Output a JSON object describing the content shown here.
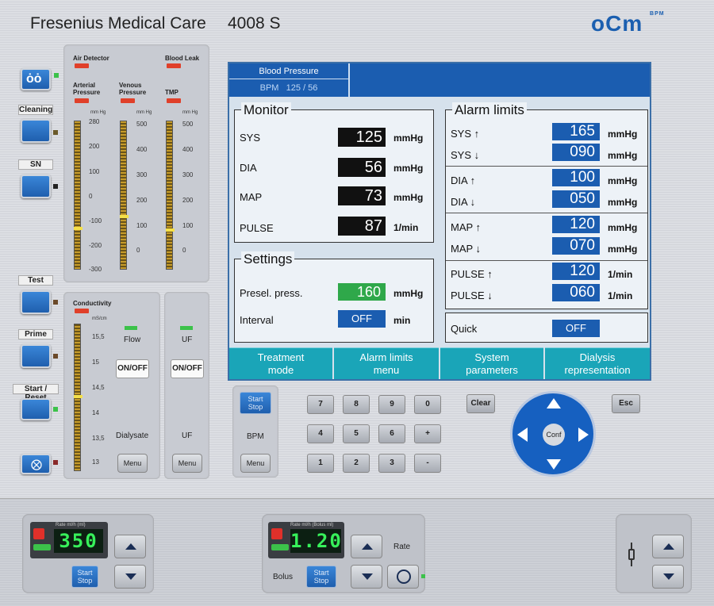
{
  "header": {
    "brand": "Fresenius Medical Care",
    "model": "4008 S",
    "logo": "oCm",
    "logo_small": "BPM"
  },
  "left_buttons": [
    {
      "label": "",
      "icon": "blood-pump-icon"
    },
    {
      "label": "Cleaning"
    },
    {
      "label": "SN"
    },
    {
      "label": "Test"
    },
    {
      "label": "Prime"
    },
    {
      "label": "Start / Reset"
    },
    {
      "label": "",
      "icon": "alarm-mute-icon"
    }
  ],
  "pressure_panel": {
    "air_detector": "Air Detector",
    "blood_leak": "Blood Leak",
    "arterial": "Arterial Pressure",
    "venous": "Venous Pressure",
    "tmp": "TMP",
    "unit": "mm Hg",
    "arterial_ticks": [
      "280",
      "200",
      "100",
      "0",
      "-100",
      "-200",
      "-300"
    ],
    "venous_ticks": [
      "500",
      "400",
      "300",
      "200",
      "100",
      "0"
    ],
    "tmp_ticks": [
      "500",
      "400",
      "300",
      "200",
      "100",
      "0"
    ]
  },
  "conductivity_panel": {
    "title": "Conductivity",
    "unit": "mS/cm",
    "ticks": [
      "15,5",
      "15",
      "14,5",
      "14",
      "13,5",
      "13"
    ],
    "flow_label": "Flow",
    "onoff": "ON/OFF",
    "dialysate_label": "Dialysate",
    "menu": "Menu"
  },
  "uf_panel": {
    "label_top": "UF",
    "onoff": "ON/OFF",
    "label_bottom": "UF",
    "menu": "Menu"
  },
  "screen": {
    "title": "Blood Pressure",
    "bpm": "BPM   125 / 56",
    "monitor": {
      "title": "Monitor",
      "rows": [
        {
          "label": "SYS",
          "value": "125",
          "unit": "mmHg"
        },
        {
          "label": "DIA",
          "value": "56",
          "unit": "mmHg"
        },
        {
          "label": "MAP",
          "value": "73",
          "unit": "mmHg"
        },
        {
          "label": "PULSE",
          "value": "87",
          "unit": "1/min"
        }
      ]
    },
    "settings": {
      "title": "Settings",
      "presel_label": "Presel. press.",
      "presel_value": "160",
      "presel_unit": "mmHg",
      "interval_label": "Interval",
      "interval_value": "OFF",
      "interval_unit": "min"
    },
    "alarm_limits": {
      "title": "Alarm limits",
      "rows": [
        {
          "label": "SYS ↑",
          "value": "165",
          "unit": "mmHg"
        },
        {
          "label": "SYS ↓",
          "value": "090",
          "unit": "mmHg"
        },
        {
          "label": "DIA ↑",
          "value": "100",
          "unit": "mmHg"
        },
        {
          "label": "DIA ↓",
          "value": "050",
          "unit": "mmHg"
        },
        {
          "label": "MAP ↑",
          "value": "120",
          "unit": "mmHg"
        },
        {
          "label": "MAP ↓",
          "value": "070",
          "unit": "mmHg"
        },
        {
          "label": "PULSE ↑",
          "value": "120",
          "unit": "1/min"
        },
        {
          "label": "PULSE ↓",
          "value": "060",
          "unit": "1/min"
        }
      ]
    },
    "quick": {
      "label": "Quick",
      "value": "OFF"
    },
    "menu": [
      {
        "line1": "Treatment",
        "line2": "mode"
      },
      {
        "line1": "Alarm limits",
        "line2": "menu"
      },
      {
        "line1": "System",
        "line2": "parameters"
      },
      {
        "line1": "Dialysis",
        "line2": "representation"
      }
    ]
  },
  "bpm_panel": {
    "start_stop": [
      "Start",
      "Stop"
    ],
    "bpm": "BPM",
    "menu": "Menu"
  },
  "keypad": {
    "row1": [
      "7",
      "8",
      "9",
      "0"
    ],
    "row2": [
      "4",
      "5",
      "6",
      "+"
    ],
    "row3": [
      "1",
      "2",
      "3",
      "-"
    ],
    "clear": "Clear",
    "esc": "Esc",
    "conf": "Conf"
  },
  "pumps": {
    "blood_pump": {
      "display": "350",
      "caption": "Rate ml/h (ml)",
      "start_stop": [
        "Start",
        "Stop"
      ]
    },
    "heparin_pump": {
      "display": "1.20",
      "caption": "Rate ml/h (Bolus ml)",
      "start_stop": [
        "Start",
        "Stop"
      ],
      "bolus": "Bolus",
      "rate": "Rate"
    }
  },
  "colors": {
    "screen_header": "#1b5db0",
    "menu_button": "#1aa5b8",
    "accent_green": "#37f05a",
    "alarm_red": "#e0402a"
  }
}
